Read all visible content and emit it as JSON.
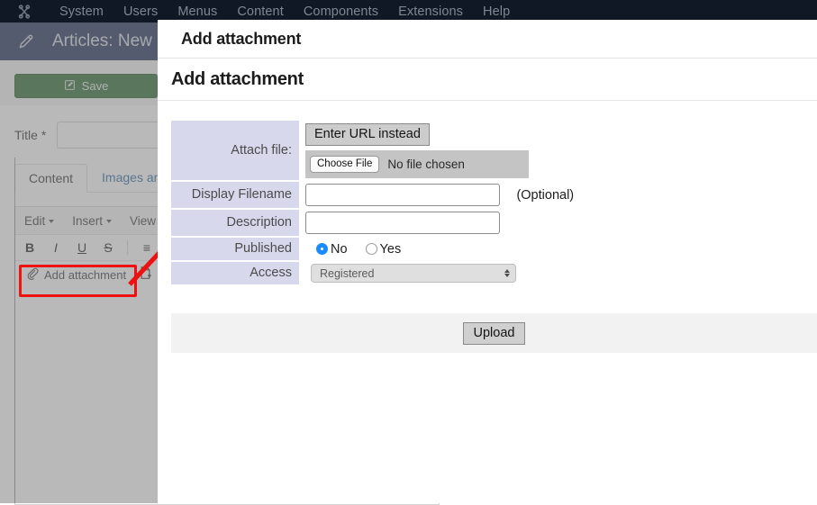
{
  "topmenu": {
    "logo_icon": "joomla-icon",
    "items": [
      {
        "label": "System"
      },
      {
        "label": "Users"
      },
      {
        "label": "Menus"
      },
      {
        "label": "Content"
      },
      {
        "label": "Components"
      },
      {
        "label": "Extensions"
      },
      {
        "label": "Help"
      }
    ]
  },
  "subhead": {
    "icon": "pencil-icon",
    "title": "Articles: New"
  },
  "toolbar": {
    "save_label": "Save",
    "save_icon": "pencil-square-icon",
    "save_color": "#2e6b33"
  },
  "editor_page": {
    "title_label": "Title *",
    "title_value": "",
    "tabs": [
      {
        "label": "Content",
        "active": true
      },
      {
        "label": "Images and",
        "active": false
      }
    ],
    "editor_menus": [
      {
        "label": "Edit"
      },
      {
        "label": "Insert"
      },
      {
        "label": "View"
      }
    ],
    "format_buttons": [
      {
        "label": "B",
        "name": "bold-icon"
      },
      {
        "label": "I",
        "name": "italic-icon"
      },
      {
        "label": "U",
        "name": "underline-icon"
      },
      {
        "label": "S",
        "name": "strikethrough-icon"
      },
      {
        "label": "≡",
        "name": "align-left-icon"
      }
    ],
    "add_attachment_label": "Add attachment",
    "add_attachment_icon": "paperclip-icon",
    "new_page_icon": "page-plus-icon"
  },
  "annotation": {
    "highlight_color": "#ee1111",
    "arrow_color": "#ee1111",
    "target": "add-attachment-button"
  },
  "dialog": {
    "titlebar": "Add attachment",
    "heading": "Add attachment",
    "fields": {
      "attach_file": {
        "label": "Attach file:",
        "url_button_label": "Enter URL instead",
        "choose_file_label": "Choose File",
        "file_status": "No file chosen"
      },
      "display_filename": {
        "label": "Display Filename",
        "value": "",
        "note": "(Optional)"
      },
      "description": {
        "label": "Description",
        "value": ""
      },
      "published": {
        "label": "Published",
        "options": [
          {
            "label": "No",
            "selected": true
          },
          {
            "label": "Yes",
            "selected": false
          }
        ],
        "selected_color": "#1a8cff"
      },
      "access": {
        "label": "Access",
        "value": "Registered"
      }
    },
    "footer": {
      "upload_label": "Upload"
    }
  }
}
